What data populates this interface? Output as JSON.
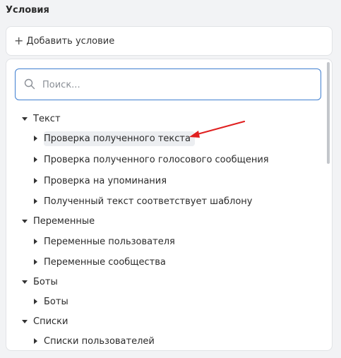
{
  "section": {
    "title": "Условия"
  },
  "add_condition": {
    "icon": "plus-icon",
    "label": "Добавить условие"
  },
  "search": {
    "placeholder": "Поиск...",
    "value": "",
    "icon": "search-icon"
  },
  "tree": {
    "groups": [
      {
        "label": "Текст",
        "expanded": true,
        "items": [
          {
            "label": "Проверка полученного текста",
            "highlighted": true
          },
          {
            "label": "Проверка полученного голосового сообщения"
          },
          {
            "label": "Проверка на упоминания"
          },
          {
            "label": "Полученный текст соответствует шаблону"
          }
        ]
      },
      {
        "label": "Переменные",
        "expanded": true,
        "items": [
          {
            "label": "Переменные пользователя"
          },
          {
            "label": "Переменные сообщества"
          }
        ]
      },
      {
        "label": "Боты",
        "expanded": true,
        "items": [
          {
            "label": "Боты"
          }
        ]
      },
      {
        "label": "Списки",
        "expanded": true,
        "items": [
          {
            "label": "Списки пользователей"
          }
        ]
      }
    ]
  },
  "colors": {
    "search_border": "#3f7fd0",
    "annotation_arrow": "#e02020",
    "highlight_bg": "#eceef1"
  }
}
